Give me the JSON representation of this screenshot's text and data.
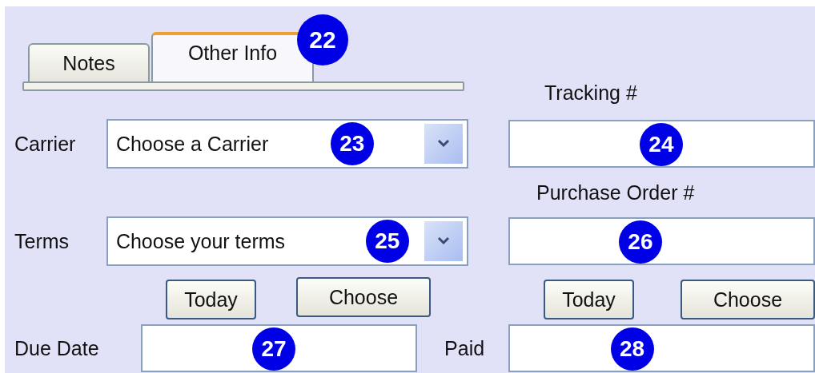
{
  "tabs": [
    {
      "label": "Notes",
      "selected": false
    },
    {
      "label": "Other Info",
      "selected": true
    }
  ],
  "tabs_badge": "22",
  "carrier": {
    "label": "Carrier",
    "value": "Choose a Carrier",
    "badge": "23"
  },
  "tracking": {
    "label": "Tracking #",
    "badge": "24"
  },
  "purchase_order": {
    "label": "Purchase Order #",
    "badge": "26"
  },
  "terms": {
    "label": "Terms",
    "value": "Choose your terms",
    "badge": "25"
  },
  "due_date": {
    "label": "Due Date",
    "badge": "27",
    "buttons": [
      "Today",
      "Choose"
    ]
  },
  "paid": {
    "label": "Paid",
    "badge": "28",
    "buttons": [
      "Today",
      "Choose"
    ]
  }
}
